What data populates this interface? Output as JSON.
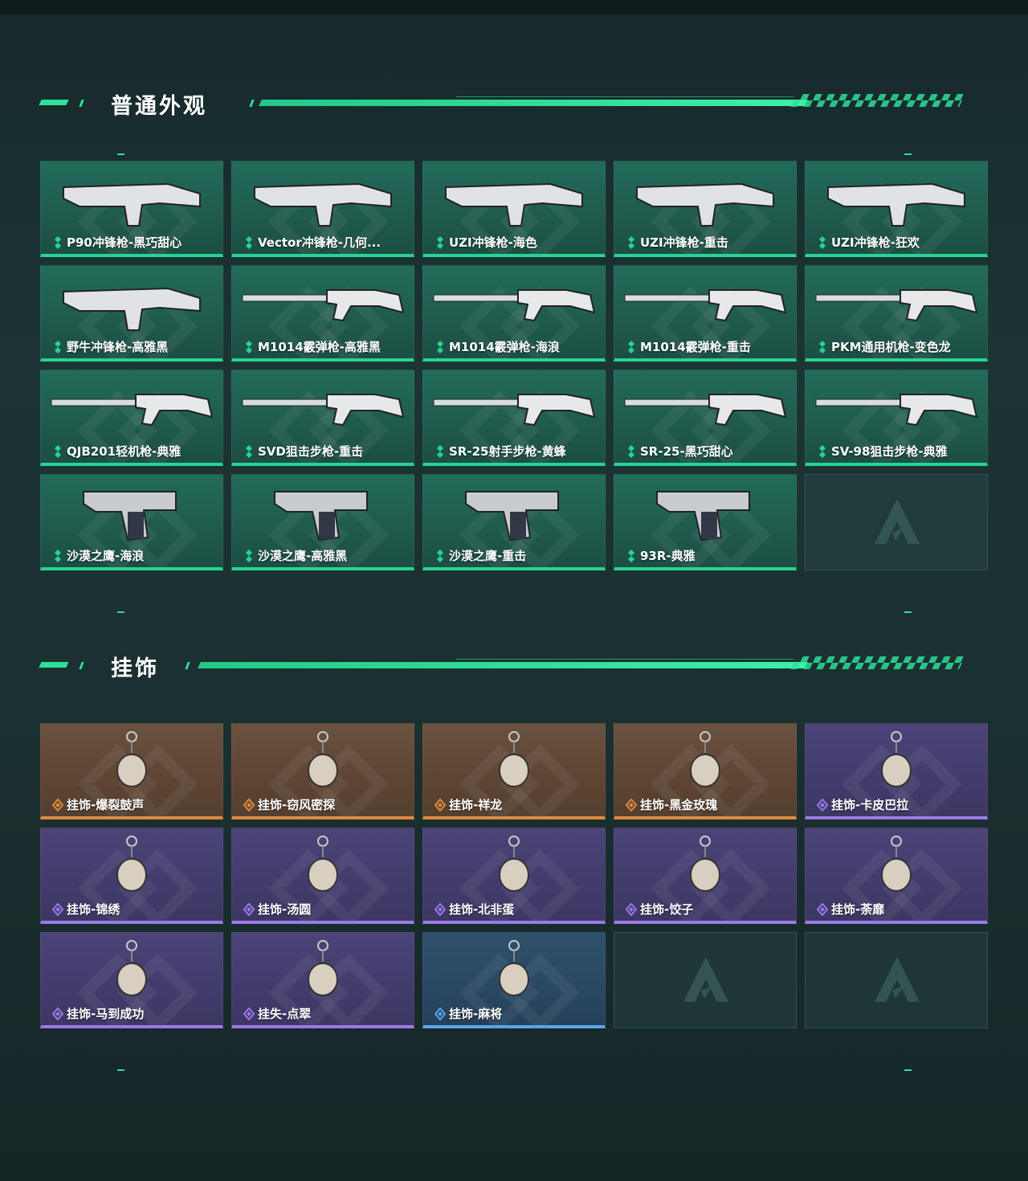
{
  "sections": {
    "normal": {
      "title": "普通外观"
    },
    "charms": {
      "title": "挂饰"
    }
  },
  "colors": {
    "accent": "#2ee09a",
    "green_rarity": "#26d491",
    "orange_rarity": "#e08a3c",
    "purple_rarity": "#9b79e8",
    "blue_rarity": "#5aa5e8"
  },
  "normal_items": [
    {
      "label": "P90冲锋枪-黑巧甜心",
      "icon": "smg-p90"
    },
    {
      "label": "Vector冲锋枪-几何...",
      "icon": "smg-vector"
    },
    {
      "label": "UZI冲锋枪-海色",
      "icon": "smg-uzi"
    },
    {
      "label": "UZI冲锋枪-重击",
      "icon": "smg-uzi"
    },
    {
      "label": "UZI冲锋枪-狂欢",
      "icon": "smg-uzi"
    },
    {
      "label": "野牛冲锋枪-高雅黑",
      "icon": "smg-bizon"
    },
    {
      "label": "M1014霰弹枪-高雅黑",
      "icon": "shotgun"
    },
    {
      "label": "M1014霰弹枪-海浪",
      "icon": "shotgun"
    },
    {
      "label": "M1014霰弹枪-重击",
      "icon": "shotgun"
    },
    {
      "label": "PKM通用机枪-变色龙",
      "icon": "lmg"
    },
    {
      "label": "QJB201轻机枪-典雅",
      "icon": "lmg"
    },
    {
      "label": "SVD狙击步枪-重击",
      "icon": "sniper"
    },
    {
      "label": "SR-25射手步枪-黄蜂",
      "icon": "rifle"
    },
    {
      "label": "SR-25-黑巧甜心",
      "icon": "rifle"
    },
    {
      "label": "SV-98狙击步枪-典雅",
      "icon": "sniper"
    },
    {
      "label": "沙漠之鹰-海浪",
      "icon": "pistol"
    },
    {
      "label": "沙漠之鹰-高雅黑",
      "icon": "pistol"
    },
    {
      "label": "沙漠之鹰-重击",
      "icon": "pistol"
    },
    {
      "label": "93R-典雅",
      "icon": "pistol"
    }
  ],
  "charm_items": [
    {
      "label": "挂饰-爆裂鼓声",
      "rarity": "orange"
    },
    {
      "label": "挂饰-窃风密探",
      "rarity": "orange"
    },
    {
      "label": "挂饰-祥龙",
      "rarity": "orange"
    },
    {
      "label": "挂饰-黑金玫瑰",
      "rarity": "orange"
    },
    {
      "label": "挂饰-卡皮巴拉",
      "rarity": "purple"
    },
    {
      "label": "挂饰-锦绣",
      "rarity": "purple"
    },
    {
      "label": "挂饰-汤圆",
      "rarity": "purple"
    },
    {
      "label": "挂饰-北非蛋",
      "rarity": "purple"
    },
    {
      "label": "挂饰-饺子",
      "rarity": "purple"
    },
    {
      "label": "挂饰-荼靡",
      "rarity": "purple"
    },
    {
      "label": "挂饰-马到成功",
      "rarity": "purple"
    },
    {
      "label": "挂失-点翠",
      "rarity": "purple"
    },
    {
      "label": "挂饰-麻将",
      "rarity": "blue"
    }
  ]
}
